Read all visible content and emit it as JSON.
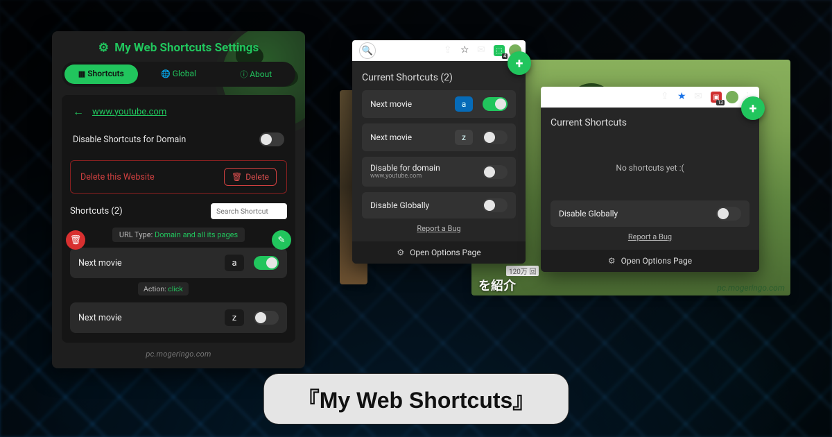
{
  "main_title_quoted": "『My Web Shortcuts』",
  "settings": {
    "title": "My Web Shortcuts Settings",
    "tabs": {
      "shortcuts": "Shortcuts",
      "global": "Global",
      "about": "About"
    },
    "domain": "www.youtube.com",
    "disable_domain": "Disable Shortcuts for Domain",
    "delete_website": "Delete this Website",
    "delete_btn": "Delete",
    "shortcuts_header": "Shortcuts (2)",
    "search_placeholder": "Search Shortcut",
    "url_type_label": "URL Type:",
    "url_type_value": "Domain and all its pages",
    "action_label": "Action:",
    "action_value": "click",
    "items": [
      {
        "name": "Next movie",
        "key": "a",
        "on": true
      },
      {
        "name": "Next movie",
        "key": "z",
        "on": false
      }
    ],
    "watermark": "pc.mogeringo.com"
  },
  "popup2": {
    "title": "Current Shortcuts (2)",
    "items": [
      {
        "name": "Next movie",
        "key": "a",
        "on": true
      },
      {
        "name": "Next movie",
        "key": "z",
        "on": false
      }
    ],
    "disable_domain": "Disable for domain",
    "disable_domain_sub": "www.youtube.com",
    "disable_global": "Disable Globally",
    "report": "Report a Bug",
    "open_options": "Open Options Page"
  },
  "popup3": {
    "title": "Current Shortcuts",
    "empty": "No shortcuts yet :(",
    "disable_global": "Disable Globally",
    "report": "Report a Bug",
    "open_options": "Open Options Page"
  },
  "bg": {
    "site": "pc.mogeringo.com",
    "jp": "を紹介",
    "views": "120万 回"
  }
}
